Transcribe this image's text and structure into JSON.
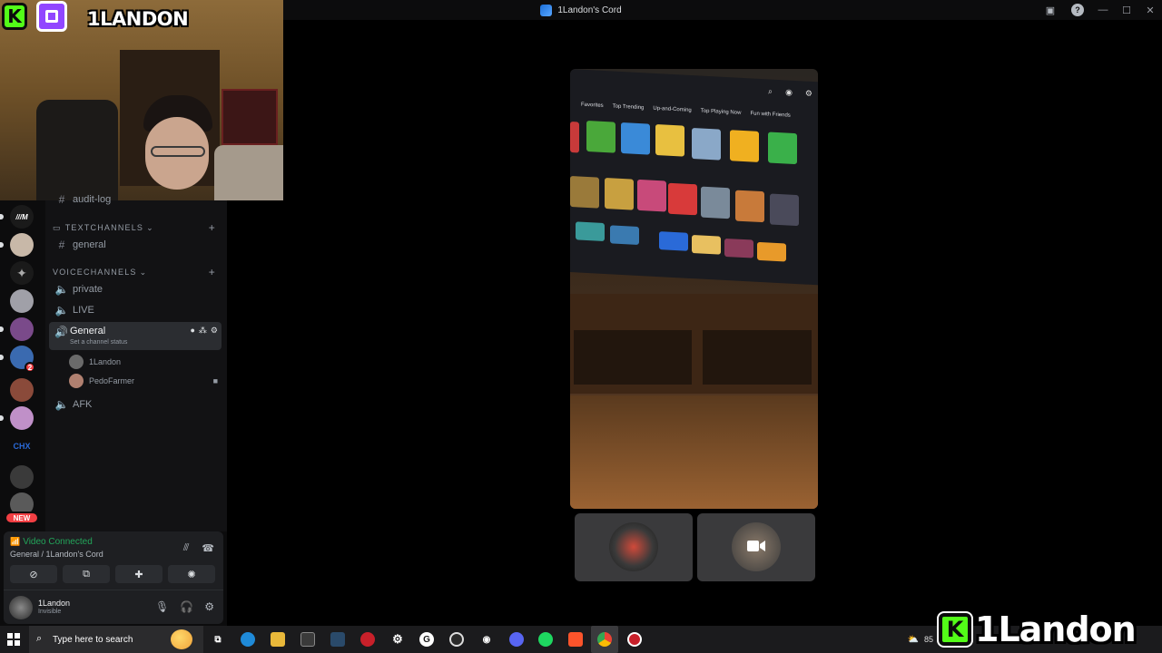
{
  "window": {
    "title": "1Landon's Cord",
    "controls": [
      "—",
      "☐",
      "✕"
    ]
  },
  "overlay": {
    "webcam_name": "1LANDON",
    "brand_name": "1Landon",
    "kick_letter": "K"
  },
  "servers": {
    "colors": [
      "#1a4fd8",
      "#c8b8a8",
      "#6a6a6a",
      "#a0a0a8",
      "#7a4a8a",
      "#3a6ab0",
      "#8a4a3a",
      "#c090c8",
      "#1a4fd8",
      "#3a3a3a",
      "#5a5a5a"
    ],
    "badge_count": "2",
    "new_label": "NEW",
    "chx_label": "CHX"
  },
  "channels": {
    "audit_log": "audit-log",
    "text_category": "TEXTCHANNELS",
    "voice_category": "VOICECHANNELS",
    "general_text": "general",
    "private": "private",
    "live": "LIVE",
    "general_voice": "General",
    "channel_status": "Set a channel status",
    "voice_users": [
      {
        "name": "1Landon",
        "color": "#6a6a6a"
      },
      {
        "name": "PedoFarmer",
        "color": "#b08070"
      }
    ],
    "afk": "AFK"
  },
  "voice_panel": {
    "status": "Video Connected",
    "sub": "General / 1Landon's Cord"
  },
  "user_panel": {
    "name": "1Landon",
    "status": "Invisible"
  },
  "tv_ui": {
    "tabs": [
      "Favorites",
      "Top Trending",
      "Up-and-Coming",
      "Top Playing Now",
      "Fun with Friends"
    ]
  },
  "taskbar": {
    "search_placeholder": "Type here to search",
    "tray_text": "85"
  }
}
